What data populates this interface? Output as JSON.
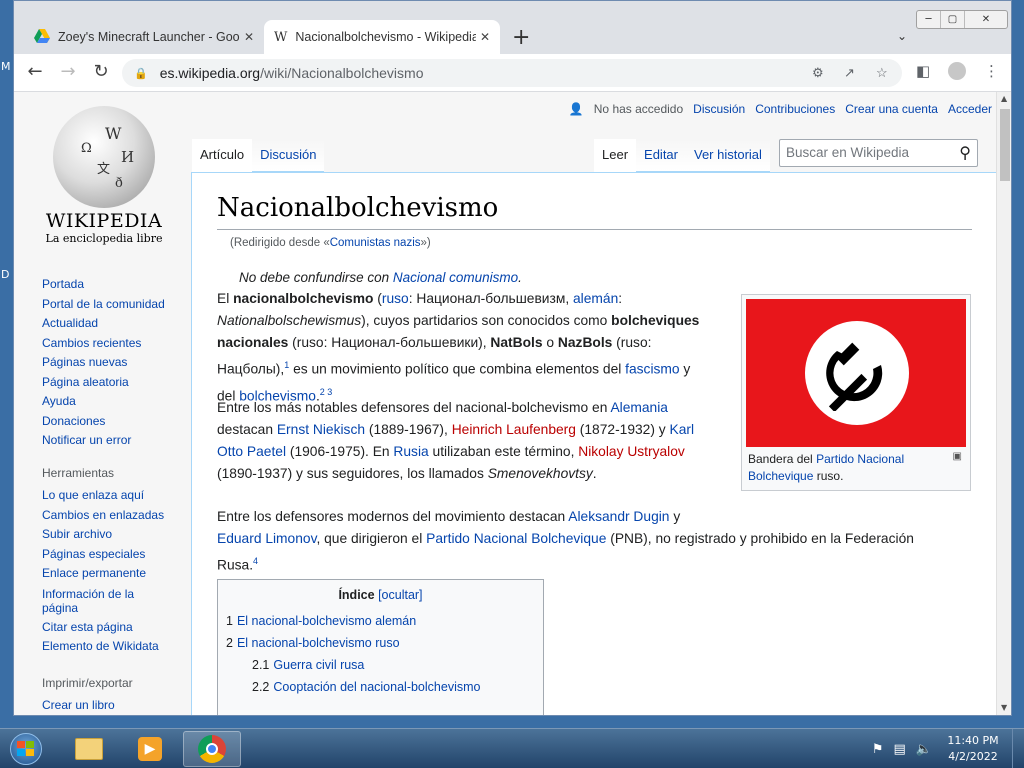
{
  "desktop": {
    "letters": [
      "M",
      "D"
    ]
  },
  "browser": {
    "tabs": [
      {
        "title": "Zoey's Minecraft Launcher - Goo",
        "icon": "google-drive-icon",
        "active": false
      },
      {
        "title": "Nacionalbolchevismo - Wikipedia",
        "icon": "wikipedia-icon",
        "active": true
      }
    ],
    "new_tab_symbol": "+",
    "url_host": "es.wikipedia.org",
    "url_path": "/wiki/Nacionalbolchevismo"
  },
  "wiki": {
    "logo_word": "WIKIPEDIA",
    "logo_tagline": "La enciclopedia libre",
    "nav": [
      "Portada",
      "Portal de la comunidad",
      "Actualidad",
      "Cambios recientes",
      "Páginas nuevas",
      "Página aleatoria",
      "Ayuda",
      "Donaciones",
      "Notificar un error"
    ],
    "tools_heading": "Herramientas",
    "tools": [
      "Lo que enlaza aquí",
      "Cambios en enlazadas",
      "Subir archivo",
      "Páginas especiales",
      "Enlace permanente",
      "Información de la página",
      "Citar esta página",
      "Elemento de Wikidata"
    ],
    "print_heading": "Imprimir/exportar",
    "print": [
      "Crear un libro"
    ],
    "personal": {
      "anon": "No has accedido",
      "links": [
        "Discusión",
        "Contribuciones",
        "Crear una cuenta",
        "Acceder"
      ]
    },
    "left_tabs": [
      "Artículo",
      "Discusión"
    ],
    "right_tabs": [
      "Leer",
      "Editar",
      "Ver historial"
    ],
    "search_placeholder": "Buscar en Wikipedia",
    "title": "Nacionalbolchevismo",
    "redirect": {
      "prefix": "(Redirigido desde «",
      "link": "Comunistas nazis",
      "suffix": "»)"
    },
    "hatnote": {
      "text": "No debe confundirse con ",
      "link": "Nacional comunismo",
      "end": "."
    },
    "infobox": {
      "caption_prefix": "Bandera del ",
      "caption_link": "Partido Nacional Bolchevique",
      "caption_suffix": " ruso.",
      "flag_colors": {
        "field": "#e8161b",
        "disc": "#ffffff",
        "symbol": "#000000"
      }
    },
    "p1": {
      "a": "El ",
      "b": "nacionalbolchevismo",
      "c": " (",
      "d": "ruso",
      "e": ": Национал-большевизм, ",
      "f": "alemán",
      "g": ":",
      "h": "Nationalbolschewismus",
      "i": "), cuyos partidarios son conocidos como ",
      "j": "bolcheviques",
      "k": "nacionales",
      "l": " (ruso: Национал-большевики), ",
      "m": "NatBols",
      "n": " o ",
      "o": "NazBols",
      "p": " (ruso:",
      "q": "Нацболы),",
      "r": "1",
      "s": " es un movimiento político que combina elementos del ",
      "t": "fascismo",
      "u": " y",
      "v": "del ",
      "w": "bolchevismo",
      "x": ".",
      "y": "2 3"
    },
    "p2": {
      "a": "Entre los más notables defensores del nacional-bolchevismo en ",
      "b": "Alemania",
      "c": "destacan ",
      "d": "Ernst Niekisch",
      "e": " (1889-1967), ",
      "f": "Heinrich Laufenberg",
      "g": " (1872-1932) y ",
      "h": "Karl",
      "i": "Otto Paetel",
      "j": " (1906-1975). En ",
      "k": "Rusia",
      "l": " utilizaban este término, ",
      "m": "Nikolay Ustryalov",
      "n": "(1890-1937) y sus seguidores, los llamados ",
      "o": "Smenovekhovtsy",
      "p": "."
    },
    "p3": {
      "a": "Entre los defensores modernos del movimiento destacan ",
      "b": "Aleksandr Dugin",
      "c": " y",
      "d": "Eduard Limonov",
      "e": ", que dirigieron el ",
      "f": "Partido Nacional Bolchevique",
      "g": " (PNB), no registrado y prohibido en la Federación",
      "h": "Rusa.",
      "i": "4"
    },
    "toc": {
      "title": "Índice",
      "toggle": "[ocultar]",
      "items": [
        {
          "num": "1",
          "label": "El nacional-bolchevismo alemán"
        },
        {
          "num": "2",
          "label": "El nacional-bolchevismo ruso"
        },
        {
          "num": "2.1",
          "label": "Guerra civil rusa"
        },
        {
          "num": "2.2",
          "label": "Cooptación del nacional-bolchevismo"
        }
      ]
    }
  },
  "taskbar": {
    "time": "11:40 PM",
    "date": "4/2/2022"
  }
}
